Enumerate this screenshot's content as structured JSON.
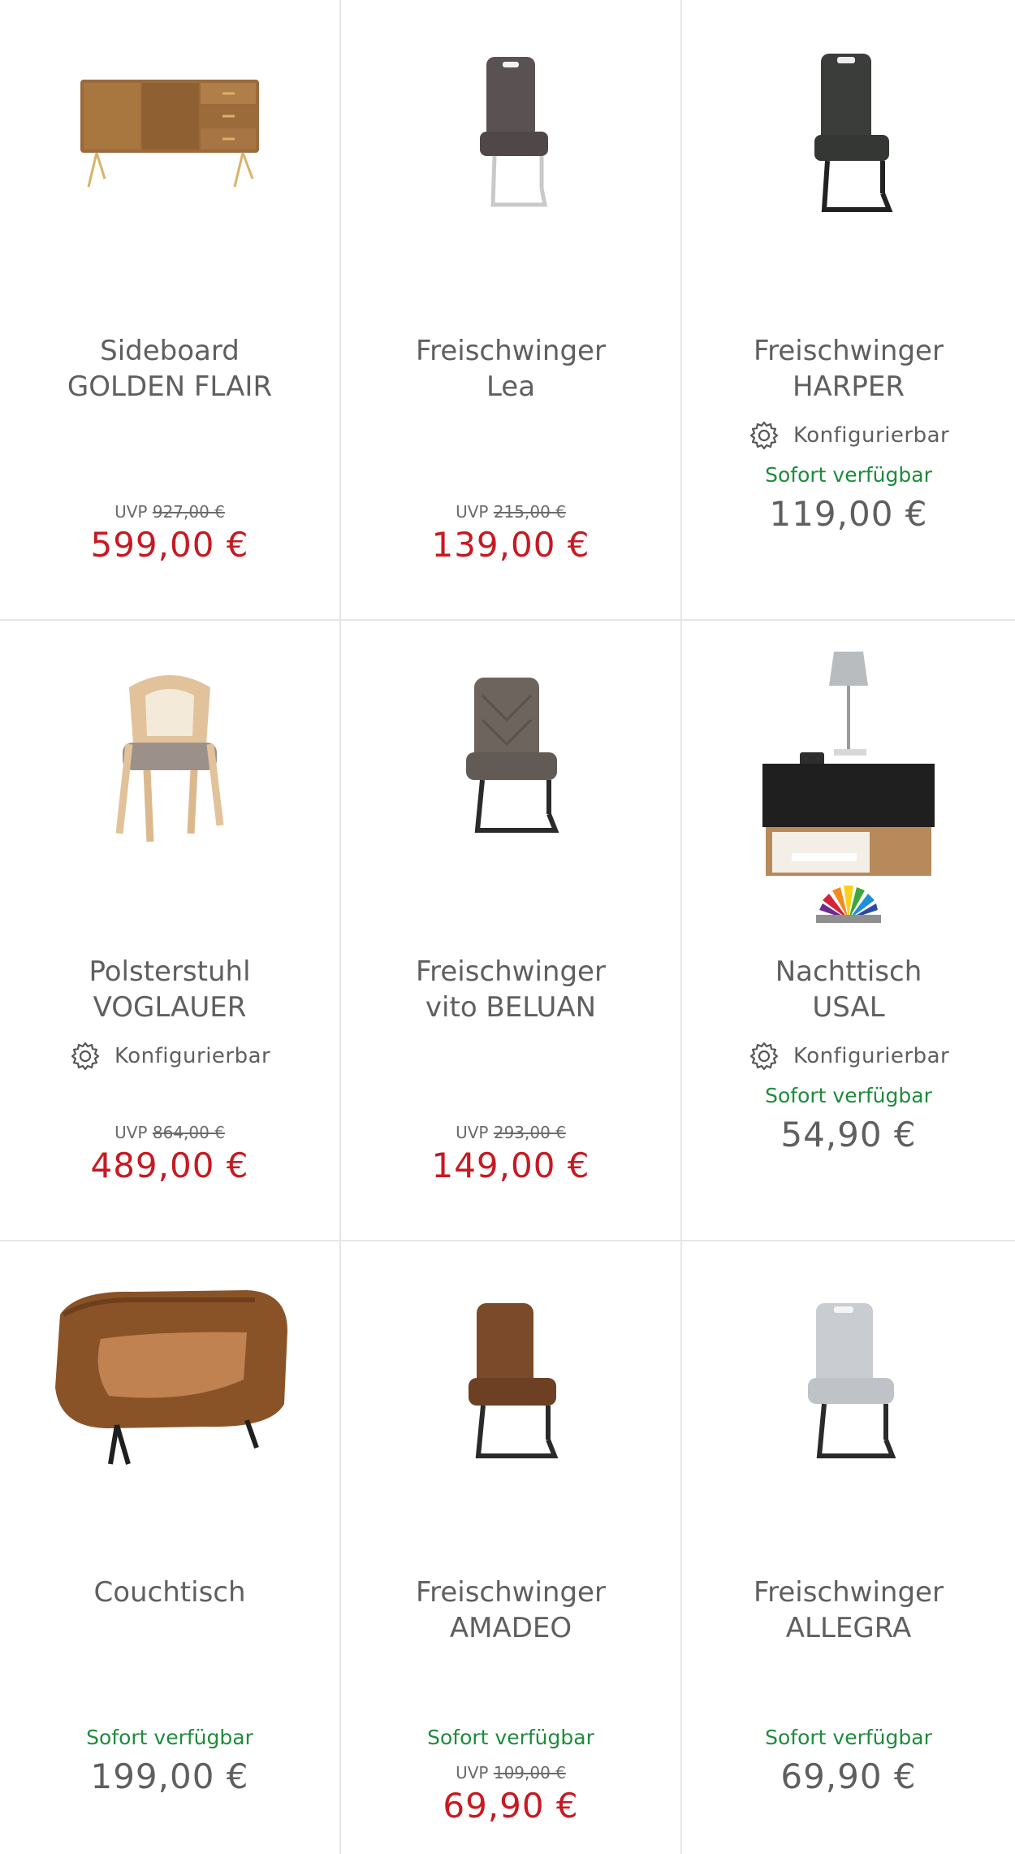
{
  "products": [
    {
      "title_line1": "Sideboard",
      "title_line2": "GOLDEN FLAIR",
      "uvp_label": "UVP",
      "uvp_price": "927,00 €",
      "price": "599,00 €",
      "image_icon": "sideboard-image"
    },
    {
      "title_line1": "Freischwinger",
      "title_line2": "Lea",
      "uvp_label": "UVP",
      "uvp_price": "215,00 €",
      "price": "139,00 €",
      "image_icon": "chair-image"
    },
    {
      "title_line1": "Freischwinger",
      "title_line2": "HARPER",
      "config_label": "Konfigurierbar",
      "availability": "Sofort verfügbar",
      "price": "119,00 €",
      "image_icon": "chair-image"
    },
    {
      "title_line1": "Polsterstuhl",
      "title_line2": "VOGLAUER",
      "config_label": "Konfigurierbar",
      "uvp_label": "UVP",
      "uvp_price": "864,00 €",
      "price": "489,00 €",
      "image_icon": "chair-image"
    },
    {
      "title_line1": "Freischwinger",
      "title_line2": "vito BELUAN",
      "uvp_label": "UVP",
      "uvp_price": "293,00 €",
      "price": "149,00 €",
      "image_icon": "chair-image"
    },
    {
      "title_line1": "Nachttisch",
      "title_line2": "USAL",
      "config_label": "Konfigurierbar",
      "availability": "Sofort verfügbar",
      "price": "54,90 €",
      "image_icon": "nightstand-image",
      "badge_icon": "color-fan-icon"
    },
    {
      "title_line1": "Couchtisch",
      "availability": "Sofort verfügbar",
      "price": "199,00 €",
      "image_icon": "coffee-table-image"
    },
    {
      "title_line1": "Freischwinger",
      "title_line2": "AMADEO",
      "availability": "Sofort verfügbar",
      "uvp_label": "UVP",
      "uvp_price": "109,00 €",
      "price": "69,90 €",
      "image_icon": "chair-image"
    },
    {
      "title_line1": "Freischwinger",
      "title_line2": "ALLEGRA",
      "availability": "Sofort verfügbar",
      "price": "69,90 €",
      "image_icon": "chair-image"
    }
  ],
  "colors": {
    "sale_price": "#c61a22",
    "regular_price": "#5f5f5f",
    "availability": "#1e8b3c",
    "divider": "#e6e6e6"
  }
}
